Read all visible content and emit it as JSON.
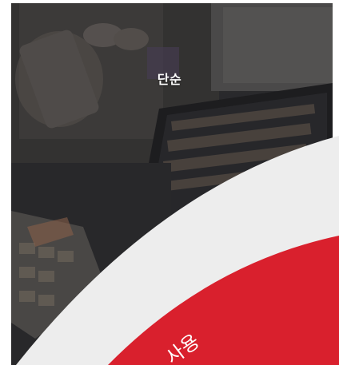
{
  "hero": {
    "title": "단순",
    "image_description_icon": "photo-backdrop"
  },
  "arc": {
    "curved_text": "사용",
    "accent_color": "#d9202d",
    "band_color": "#ededed"
  }
}
